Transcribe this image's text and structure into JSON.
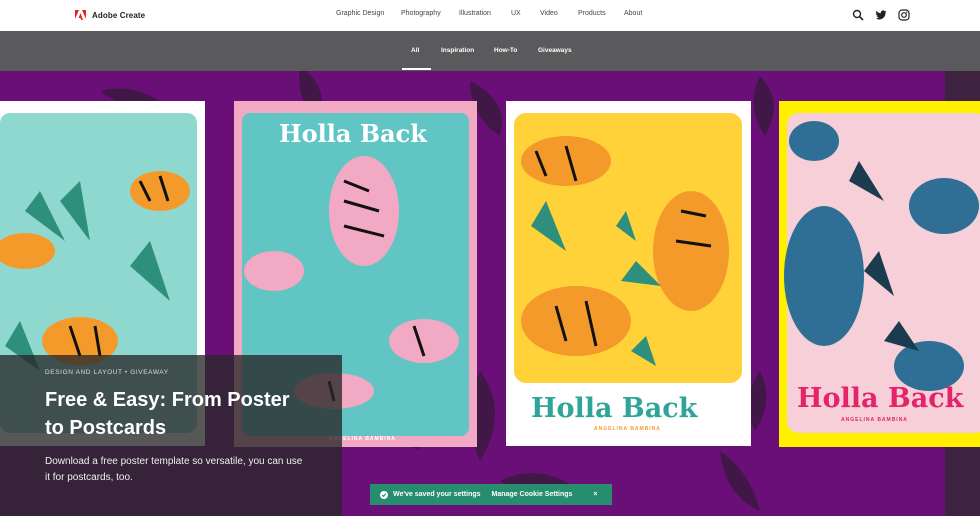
{
  "brand": {
    "name": "Adobe Create",
    "logo_icon": "adobe-logo-icon",
    "color": "#e1251b"
  },
  "nav": [
    "Graphic Design",
    "Photography",
    "Illustration",
    "UX",
    "Video",
    "Products",
    "About"
  ],
  "header_icons": [
    "search-icon",
    "twitter-icon",
    "instagram-icon"
  ],
  "subnav": {
    "items": [
      "All",
      "Inspiration",
      "How-To",
      "Giveaways"
    ],
    "active": "All"
  },
  "feature": {
    "tag": "DESIGN AND LAYOUT • GIVEAWAY",
    "title": "Free & Easy: From Poster to Postcards",
    "description": "Download a free poster template so versatile, you can use it for postcards, too."
  },
  "posters": [
    {
      "title": "Holla Back",
      "subtitle": "ANGELINA BAMBINA",
      "bg": "#f2a9c4",
      "panel": "#61c5c4"
    },
    {
      "title": "Holla Back",
      "subtitle": "ANGELINA BAMBINA",
      "bg": "#ffffff",
      "panel": "#ffd23a"
    },
    {
      "title": "Holla Back",
      "subtitle": "ANGELINA BAMBINA",
      "bg": "#fff000",
      "panel": "#f7cfd8"
    }
  ],
  "cookie": {
    "message": "We've saved your settings",
    "manage": "Manage Cookie Settings",
    "close": "×"
  },
  "colors": {
    "hero_purple": "#6a0f78",
    "cookie_green": "#268e6c",
    "subbar_gray": "#5a5a5c"
  }
}
